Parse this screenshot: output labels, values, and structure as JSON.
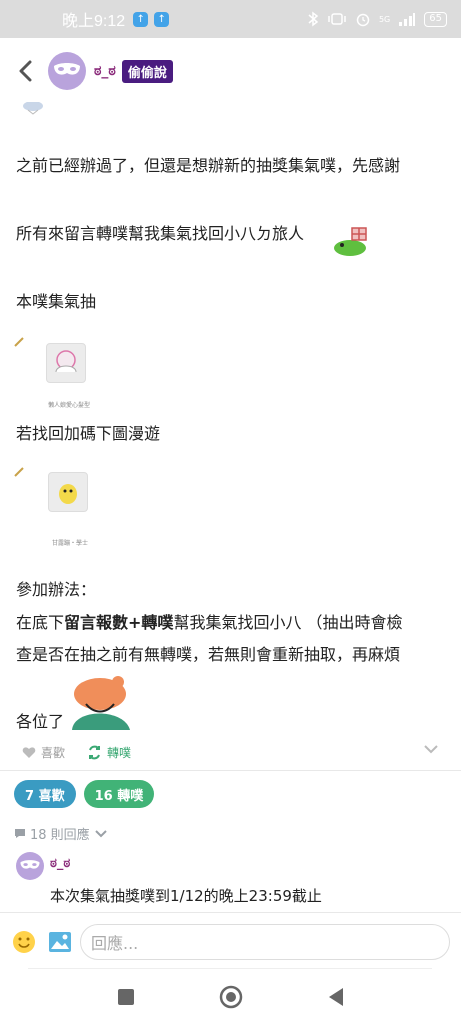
{
  "status_bar": {
    "time": "晚上9:12",
    "signal_label": "5G",
    "battery": "65"
  },
  "header": {
    "author": "ಠ_ಠ",
    "qualifier": "偷偷說"
  },
  "post": {
    "lines": [
      "之前已經辦過了，但還是想辦新的抽獎集氣噗，先感謝",
      "所有來留言轉噗幫我集氣找回小八ㄉ旅人",
      "本噗集氣抽",
      "若找回加碼下圖漫遊",
      "參加辦法：",
      "在底下",
      "留言報數+轉噗",
      "幫我集氣找回小八 （抽出時會檢",
      "查是否在抽之前有無轉噗，若無則會重新抽取，再麻煩",
      "各位了"
    ],
    "thumb1_caption": "懶人娘愛心髮型",
    "thumb2_caption": "甘露蹦・學士"
  },
  "actions": {
    "like_label": "喜歡",
    "replurk_label": "轉噗"
  },
  "badges": {
    "likes": "7 喜歡",
    "replurks": "16 轉噗"
  },
  "responses": {
    "count_label": "18 則回應"
  },
  "comment": {
    "author": "ಠ_ಠ",
    "text": "本次集氣抽獎噗到1/12的晚上23:59截止"
  },
  "reply": {
    "placeholder": "回應..."
  },
  "colors": {
    "like_badge": "#3a9bc2",
    "replurk_badge": "#41b377",
    "qualifier_bg": "#4a1c80",
    "author": "#8a2a7a"
  }
}
